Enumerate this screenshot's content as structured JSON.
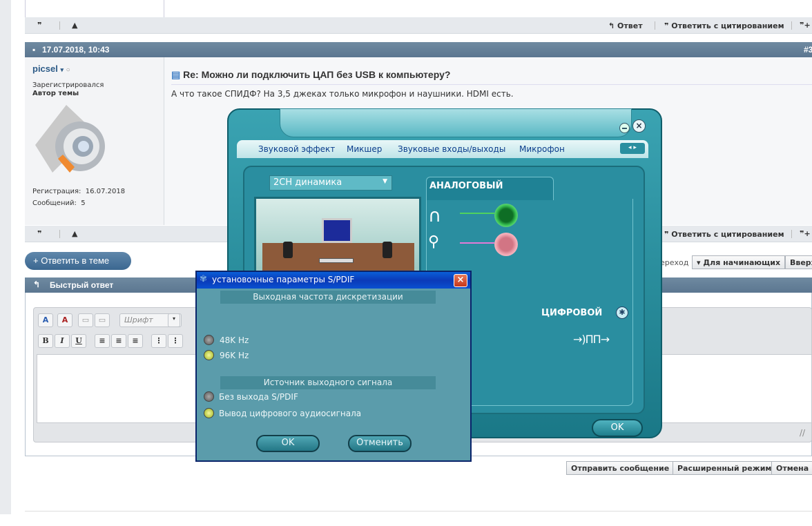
{
  "colors": {
    "header_blue": "#5b7690",
    "panel_teal": "#1a7887",
    "dialog_teal": "#5b9cab",
    "title_blue": "#0a5fd8",
    "jack_green": "#12a23a",
    "jack_pink": "#e07a8c"
  },
  "post_toolbar": {
    "reply_label": "Ответ",
    "reply_quote_label": "Ответить с цитированием",
    "post_number_partial": "#3"
  },
  "post": {
    "datetime": "17.07.2018, 10:43",
    "username": "picsel",
    "user_status": "Зарегистрировался",
    "user_role": "Автор темы",
    "registered_label": "Регистрация:",
    "registered_value": "16.07.2018",
    "messages_label": "Сообщений:",
    "messages_value": "5",
    "title": "Re: Можно ли подключить ЦАП без USB к компьютеру?",
    "text": "А что такое СПИДФ? На 3,5 джеках только микрофон и наушники. HDMI есть."
  },
  "reply_button": "+ Ответить в теме",
  "nav": {
    "jump_partial": "ереход",
    "forum_select": "▾ Для начинающих",
    "top_partial": "Вверх"
  },
  "quick_reply": {
    "title": "Быстрый ответ",
    "font_placeholder": "Шрифт",
    "bold": "B",
    "italic": "I",
    "underline": "U"
  },
  "bottom_buttons": {
    "send": "Отправить сообщение",
    "advanced": "Расширенный режим",
    "cancel": "Отмена"
  },
  "realtek": {
    "tabs": [
      "Звуковой эффект",
      "Микшер",
      "Звуковые входы/выходы",
      "Микрофон"
    ],
    "speaker_config": "2CH динамика",
    "analog_label": "АНАЛОГОВЫЙ",
    "digital_label": "ЦИФРОВОЙ",
    "ok_label": "OK"
  },
  "spdif_dialog": {
    "title": "установочные параметры S/PDIF",
    "section_rate": "Выходная частота дискретизации",
    "rate_options": [
      "48K Hz",
      "96K Hz"
    ],
    "section_source": "Источник выходного сигнала",
    "source_options": [
      "Без выхода S/PDIF",
      "Вывод цифрового аудиосигнала"
    ],
    "ok": "OK",
    "cancel": "Отменить"
  }
}
